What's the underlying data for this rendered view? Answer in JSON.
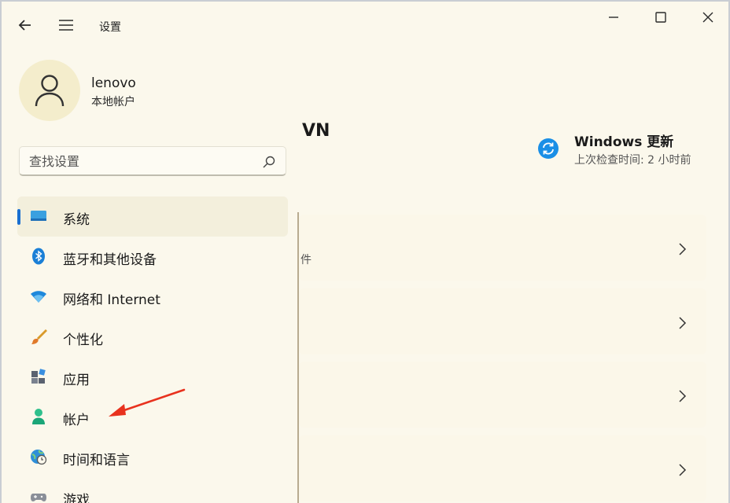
{
  "window": {
    "title": "设置"
  },
  "user": {
    "name": "lenovo",
    "account_type": "本地帐户"
  },
  "search": {
    "placeholder": "查找设置"
  },
  "nav": {
    "items": [
      {
        "label": "系统",
        "icon": "display-icon",
        "active": true
      },
      {
        "label": "蓝牙和其他设备",
        "icon": "bluetooth-icon"
      },
      {
        "label": "网络和 Internet",
        "icon": "wifi-icon"
      },
      {
        "label": "个性化",
        "icon": "brush-icon"
      },
      {
        "label": "应用",
        "icon": "apps-icon"
      },
      {
        "label": "帐户",
        "icon": "account-icon"
      },
      {
        "label": "时间和语言",
        "icon": "globe-clock-icon"
      },
      {
        "label": "游戏",
        "icon": "gamepad-icon"
      }
    ]
  },
  "main": {
    "title": "VN",
    "update": {
      "title": "Windows 更新",
      "subtitle": "上次检查时间: 2 小时前"
    },
    "cards": [
      {
        "desc": "件"
      },
      {
        "desc": ""
      },
      {
        "desc": ""
      },
      {
        "desc": ""
      }
    ]
  },
  "colors": {
    "accent": "#1a6fd1",
    "background": "#fbf8ec",
    "annotation_arrow": "#e8321e"
  }
}
